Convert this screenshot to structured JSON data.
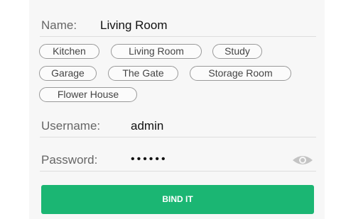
{
  "form": {
    "name_label": "Name:",
    "name_value": "Living Room",
    "room_chips": [
      "Kitchen",
      "Living Room",
      "Study",
      "Garage",
      "The Gate",
      "Storage Room",
      "Flower House"
    ],
    "username_label": "Username:",
    "username_value": "admin",
    "password_label": "Password:",
    "password_masked": "••••••",
    "password_toggle_icon": "eye-icon",
    "submit_label": "BIND IT"
  },
  "colors": {
    "accent": "#1bb673",
    "panel_background": "#f7f7f7",
    "divider": "#dedede"
  }
}
